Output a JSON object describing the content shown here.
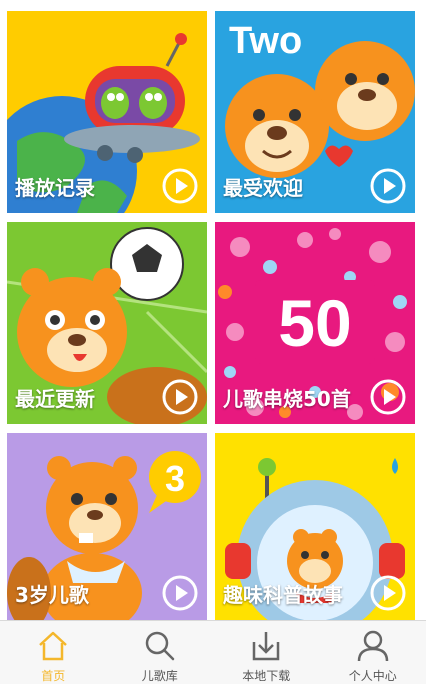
{
  "tiles": [
    {
      "label": "播放记录",
      "bg": "#ffcc00"
    },
    {
      "label": "最受欢迎",
      "bg": "#29a3e0"
    },
    {
      "label": "最近更新",
      "bg": "#7cc832"
    },
    {
      "label": "儿歌串烧50首",
      "bg": "#e8197f",
      "badge": "50"
    },
    {
      "label": "3岁儿歌",
      "bg": "#b99be6",
      "badge": "3"
    },
    {
      "label": "趣味科普故事",
      "bg": "#ffe100"
    }
  ],
  "tile2_text": "Two",
  "tabs": [
    {
      "label": "首页",
      "icon": "home-icon",
      "active": true
    },
    {
      "label": "儿歌库",
      "icon": "search-icon",
      "active": false
    },
    {
      "label": "本地下载",
      "icon": "download-icon",
      "active": false
    },
    {
      "label": "个人中心",
      "icon": "person-icon",
      "active": false
    }
  ],
  "colors": {
    "accent": "#f4b72b",
    "inactive": "#666666"
  }
}
